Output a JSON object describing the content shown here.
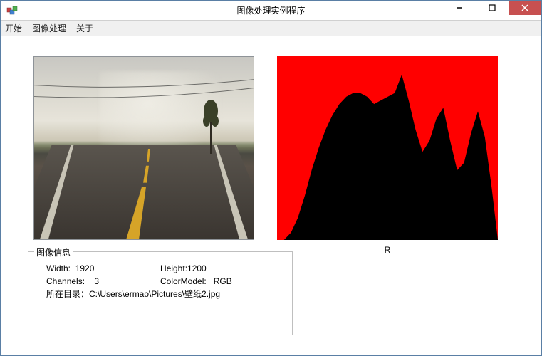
{
  "titlebar": {
    "title": "图像处理实例程序"
  },
  "menu": {
    "start": "开始",
    "imageproc": "图像处理",
    "about": "关于"
  },
  "histogram": {
    "label": "R"
  },
  "groupbox": {
    "title": "图像信息",
    "width_label": "Width:",
    "width_value": "1920",
    "height_label": "Height:",
    "height_value": "1200",
    "channels_label": "Channels:",
    "channels_value": "3",
    "colormodel_label": "ColorModel:",
    "colormodel_value": "RGB",
    "dir_label": "所在目录：",
    "dir_value": "C:\\Users\\ermao\\Pictures\\壁纸2.jpg"
  },
  "chart_data": {
    "type": "area",
    "title": "R",
    "xlabel": "",
    "ylabel": "",
    "xlim": [
      0,
      255
    ],
    "ylim": [
      0,
      100
    ],
    "series": [
      {
        "name": "R",
        "color": "#ff0000",
        "x": [
          0,
          8,
          16,
          24,
          32,
          40,
          48,
          56,
          64,
          72,
          80,
          88,
          96,
          104,
          112,
          120,
          128,
          136,
          144,
          152,
          160,
          168,
          176,
          184,
          192,
          200,
          208,
          216,
          224,
          232,
          240,
          248,
          255
        ],
        "values": [
          100,
          100,
          96,
          88,
          76,
          62,
          50,
          40,
          32,
          26,
          22,
          20,
          20,
          22,
          26,
          24,
          22,
          20,
          10,
          24,
          40,
          52,
          46,
          34,
          28,
          46,
          62,
          58,
          42,
          30,
          44,
          72,
          100
        ]
      }
    ]
  }
}
